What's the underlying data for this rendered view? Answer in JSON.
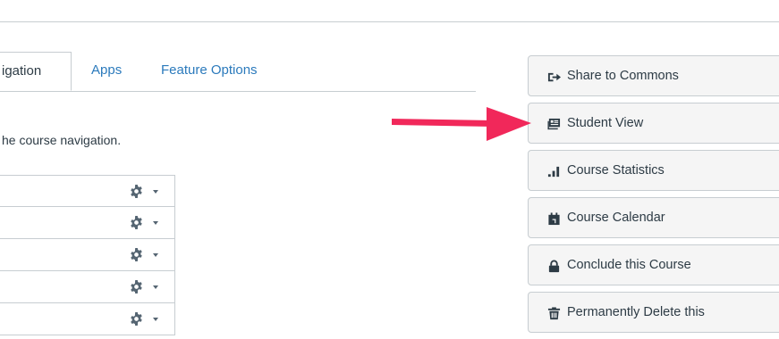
{
  "tabs": [
    {
      "label": "igation",
      "active": true
    },
    {
      "label": "Apps",
      "active": false
    },
    {
      "label": "Feature Options",
      "active": false
    }
  ],
  "navigation": {
    "instructions": "he course navigation.",
    "rows": [
      {
        "icon": "gear-icon",
        "menu": "chevron-down-icon"
      },
      {
        "icon": "gear-icon",
        "menu": "chevron-down-icon"
      },
      {
        "icon": "gear-icon",
        "menu": "chevron-down-icon"
      },
      {
        "icon": "gear-icon",
        "menu": "chevron-down-icon"
      },
      {
        "icon": "gear-icon",
        "menu": "chevron-down-icon"
      }
    ]
  },
  "sidebar": {
    "buttons": [
      {
        "label": "Share to Commons",
        "icon": "share-icon"
      },
      {
        "label": "Student View",
        "icon": "student-view-icon"
      },
      {
        "label": "Course Statistics",
        "icon": "bar-chart-icon"
      },
      {
        "label": "Course Calendar",
        "icon": "calendar-icon"
      },
      {
        "label": "Conclude this Course",
        "icon": "lock-icon"
      },
      {
        "label": "Permanently Delete this",
        "icon": "trash-icon"
      }
    ]
  },
  "colors": {
    "link": "#2b7abc",
    "text": "#2d3b45",
    "border": "#c7cdd1",
    "button_bg": "#f5f5f5",
    "arrow": "#f1285a"
  }
}
